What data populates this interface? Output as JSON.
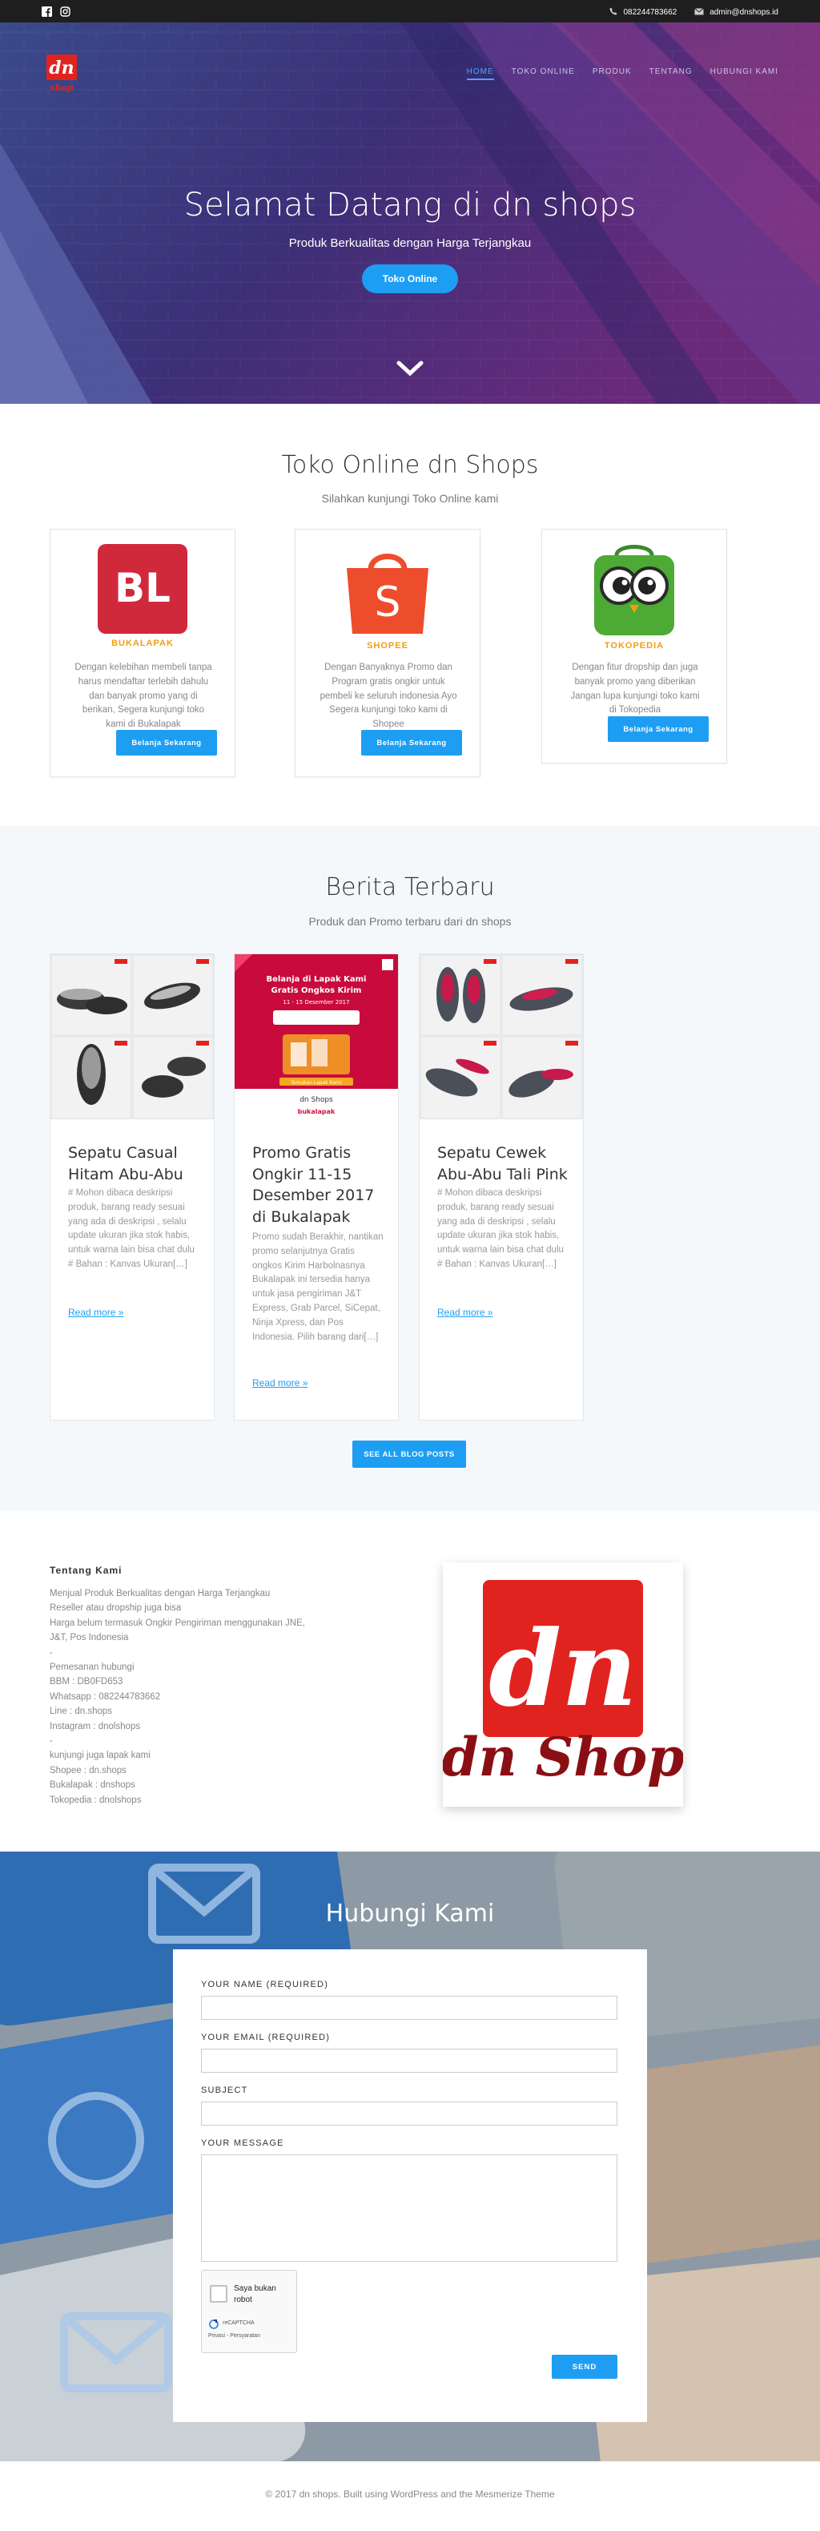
{
  "topbar": {
    "phone": "082244783662",
    "email": "admin@dnshops.id"
  },
  "brand": {
    "logo_text": "dn",
    "logo_sub": "shop"
  },
  "nav": {
    "items": [
      "HOME",
      "TOKO ONLINE",
      "PRODUK",
      "TENTANG",
      "HUBUNGI KAMI"
    ],
    "active": "HOME"
  },
  "hero": {
    "title": "Selamat Datang di dn shops",
    "subtitle": "Produk Berkualitas dengan Harga Terjangkau",
    "cta": "Toko Online"
  },
  "stores_section": {
    "title": "Toko Online dn Shops",
    "subtitle": "Silahkan kunjungi Toko Online kami",
    "stores": [
      {
        "logo_text": "BL",
        "name": "BUKALAPAK",
        "desc": "Dengan kelebihan membeli tanpa harus mendaftar terlebih dahulu dan banyak promo yang di berikan, Segera kunjungi toko kami di Bukalapak",
        "button": "Belanja Sekarang"
      },
      {
        "logo_text": "S",
        "name": "SHOPEE",
        "desc": "Dengan Banyaknya Promo dan Program gratis ongkir untuk pembeli ke seluruh indonesia Ayo Segera kunjungi toko kami di Shopee",
        "button": "Belanja Sekarang"
      },
      {
        "logo_text": "",
        "name": "TOKOPEDIA",
        "desc": "Dengan fitur dropship dan juga banyak promo yang diberikan Jangan lupa kunjungi toko kami di Tokopedia",
        "button": "Belanja Sekarang"
      }
    ]
  },
  "blog": {
    "title": "Berita Terbaru",
    "subtitle": "Produk dan Promo terbaru dari dn shops",
    "posts": [
      {
        "title": "Sepatu Casual Hitam Abu-Abu",
        "excerpt": "# Mohon dibaca deskripsi produk, barang ready sesuai yang ada di deskripsi , selalu update ukuran jika stok habis, untuk warna lain bisa chat dulu # Bahan : Kanvas Ukuran[…]",
        "read_more": "Read more"
      },
      {
        "title": "Promo Gratis Ongkir 11-15 Desember 2017 di Bukalapak",
        "excerpt": "Promo sudah Berakhir, nantikan promo selanjutnya Gratis ongkos Kirim Harbolnasnya Bukalapak ini tersedia hanya untuk jasa pengiriman J&T Express, Grab Parcel, SiCepat, Ninja Xpress, dan Pos Indonesia. Pilih barang dari[…]",
        "read_more": "Read more",
        "banner_title": "Belanja di Lapak Kami Gratis Ongkos Kirim",
        "banner_date": "11 - 15 Desember 2017",
        "banner_footer": "Temukan Lapak Kami",
        "banner_shop": "dn Shops",
        "banner_brand": "bukalapak"
      },
      {
        "title": "Sepatu Cewek Abu-Abu Tali Pink",
        "excerpt": "# Mohon dibaca deskripsi produk, barang ready sesuai yang ada di deskripsi , selalu update ukuran jika stok habis, untuk warna lain bisa chat dulu # Bahan : Kanvas Ukuran[…]",
        "read_more": "Read more"
      }
    ],
    "see_all": "SEE ALL BLOG POSTS"
  },
  "about": {
    "title": "Tentang Kami",
    "lines": [
      "Menjual Produk Berkualitas dengan Harga Terjangkau",
      "Reseller atau dropship juga bisa",
      "Harga belum termasuk Ongkir Pengiriman menggunakan JNE,",
      "J&T, Pos Indonesia",
      "-",
      "Pemesanan hubungi",
      "BBM : DB0FD653",
      "Whatsapp : 082244783662",
      "Line : dn.shops",
      "Instagram : dnolshops",
      "-",
      "kunjungi juga lapak kami",
      "Shopee : dn.shops",
      "Bukalapak : dnshops",
      "Tokopedia : dnolshops"
    ],
    "logo_big": "dn",
    "logo_word": "dn Shop"
  },
  "contact": {
    "title": "Hubungi Kami",
    "name_label": "YOUR NAME (REQUIRED)",
    "email_label": "YOUR EMAIL (REQUIRED)",
    "subject_label": "SUBJECT",
    "message_label": "YOUR MESSAGE",
    "captcha_text": "Saya bukan robot",
    "captcha_brand": "reCAPTCHA",
    "captcha_links": "Privasi - Persyaratan",
    "send": "SEND"
  },
  "footer": {
    "text": "© 2017 dn shops. Built using WordPress and the Mesmerize Theme"
  },
  "colors": {
    "accent": "#1e9ef3",
    "hero_dark": "#2c2a6b",
    "brand_red": "#e1231f"
  }
}
